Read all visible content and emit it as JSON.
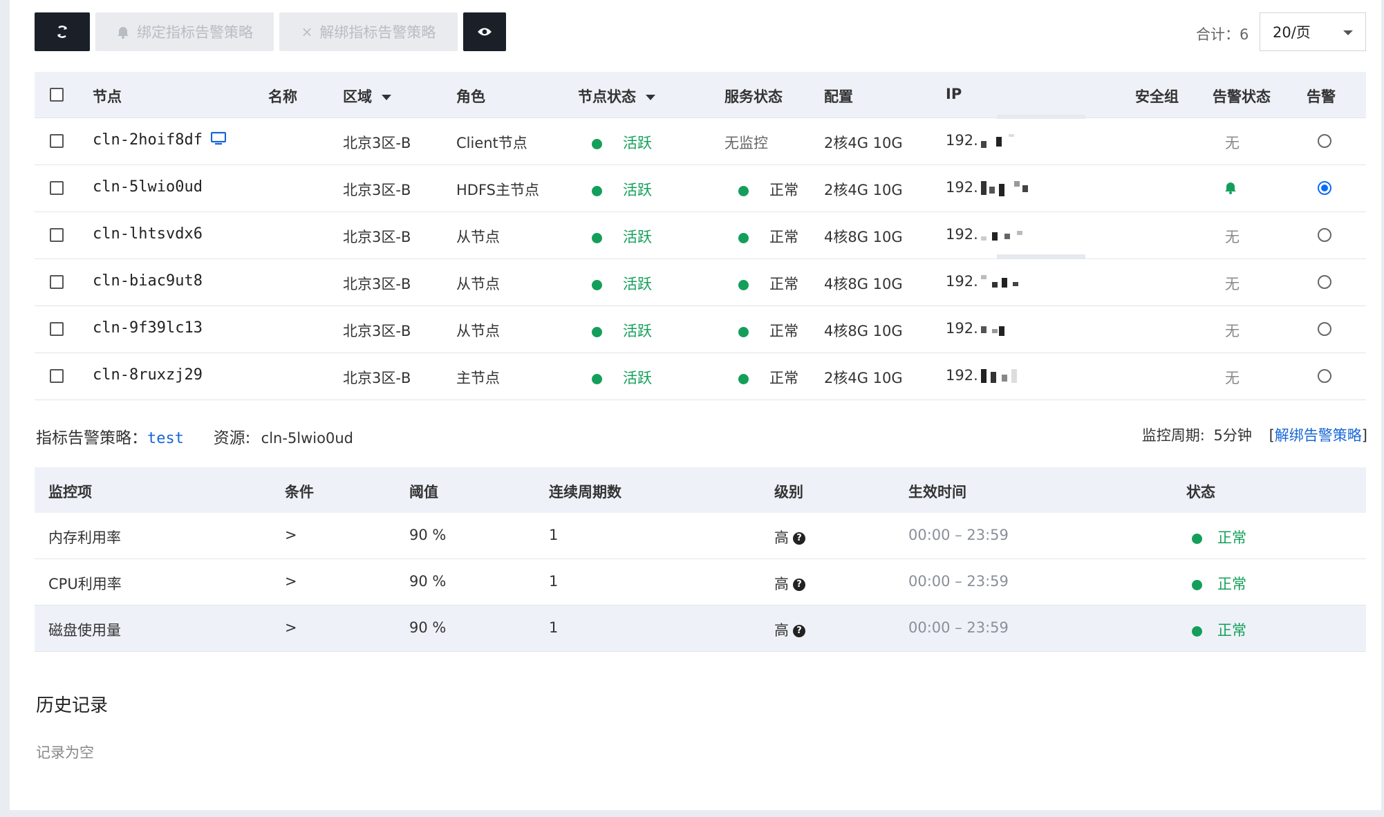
{
  "toolbar": {
    "refresh_icon": "refresh-icon",
    "bind_label": "绑定指标告警策略",
    "unbind_label": "解绑指标告警策略",
    "view_icon": "eye-icon",
    "total": "合计：6",
    "page_size": "20/页"
  },
  "nodes": {
    "headers": {
      "node": "节点",
      "name": "名称",
      "region": "区域",
      "role": "角色",
      "node_status": "节点状态",
      "service_status": "服务状态",
      "config": "配置",
      "ip": "IP",
      "security_group": "安全组",
      "alarm_status": "告警状态",
      "alarm": "告警"
    },
    "rows": [
      {
        "id": "cln-2hoif8df",
        "region": "北京3区-B",
        "role": "Client节点",
        "node_status": "活跃",
        "service_status": "无监控",
        "config": "2核4G 10G",
        "ip": "192.",
        "alarm_status": "无",
        "selected": false
      },
      {
        "id": "cln-5lwio0ud",
        "region": "北京3区-B",
        "role": "HDFS主节点",
        "node_status": "活跃",
        "service_status": "正常",
        "config": "2核4G 10G",
        "ip": "192.",
        "alarm_status": "",
        "selected": true
      },
      {
        "id": "cln-lhtsvdx6",
        "region": "北京3区-B",
        "role": "从节点",
        "node_status": "活跃",
        "service_status": "正常",
        "config": "4核8G 10G",
        "ip": "192.",
        "alarm_status": "无",
        "selected": false
      },
      {
        "id": "cln-biac9ut8",
        "region": "北京3区-B",
        "role": "从节点",
        "node_status": "活跃",
        "service_status": "正常",
        "config": "4核8G 10G",
        "ip": "192.",
        "alarm_status": "无",
        "selected": false
      },
      {
        "id": "cln-9f39lc13",
        "region": "北京3区-B",
        "role": "从节点",
        "node_status": "活跃",
        "service_status": "正常",
        "config": "4核8G 10G",
        "ip": "192.",
        "alarm_status": "无",
        "selected": false
      },
      {
        "id": "cln-8ruxzj29",
        "region": "北京3区-B",
        "role": "主节点",
        "node_status": "活跃",
        "service_status": "正常",
        "config": "2核4G 10G",
        "ip": "192.",
        "alarm_status": "无",
        "selected": false
      }
    ]
  },
  "policy": {
    "label": "指标告警策略：",
    "name": "test",
    "resource_label": "资源:",
    "resource": "cln-5lwio0ud",
    "period_label": "监控周期:",
    "period": "5分钟",
    "unbind_link": "解绑告警策略",
    "bracket_open": "[",
    "bracket_close": "]"
  },
  "rules": {
    "headers": {
      "metric": "监控项",
      "condition": "条件",
      "threshold": "阈值",
      "periods": "连续周期数",
      "level": "级别",
      "effective": "生效时间",
      "status": "状态"
    },
    "rows": [
      {
        "metric": "内存利用率",
        "condition": ">",
        "threshold": "90 %",
        "periods": "1",
        "level": "高",
        "effective": "00:00 – 23:59",
        "status": "正常"
      },
      {
        "metric": "CPU利用率",
        "condition": ">",
        "threshold": "90 %",
        "periods": "1",
        "level": "高",
        "effective": "00:00 – 23:59",
        "status": "正常"
      },
      {
        "metric": "磁盘使用量",
        "condition": ">",
        "threshold": "90 %",
        "periods": "1",
        "level": "高",
        "effective": "00:00 – 23:59",
        "status": "正常"
      }
    ]
  },
  "history": {
    "title": "历史记录",
    "empty": "记录为空"
  },
  "colors": {
    "active_green": "#139f5a",
    "link_blue": "#1766d6",
    "radio_blue": "#0a6cf5",
    "dark_button": "#1b1f27"
  }
}
